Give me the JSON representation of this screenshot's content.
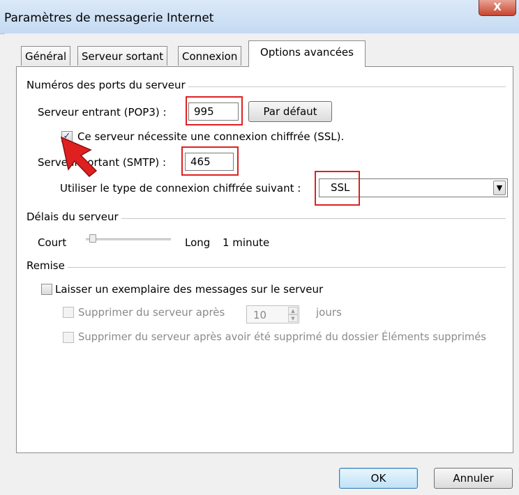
{
  "window": {
    "title": "Paramètres de messagerie Internet",
    "close_label": "X"
  },
  "tabs": [
    {
      "label": "Général",
      "active": false
    },
    {
      "label": "Serveur sortant",
      "active": false
    },
    {
      "label": "Connexion",
      "active": false
    },
    {
      "label": "Options avancées",
      "active": true
    }
  ],
  "ports": {
    "group_label": "Numéros des ports du serveur",
    "incoming_label": "Serveur entrant (POP3) :",
    "incoming_value": "995",
    "default_button": "Par défaut",
    "ssl_checkbox_label": "Ce serveur nécessite une connexion chiffrée (SSL).",
    "ssl_checked": true,
    "outgoing_label": "Serveur sortant (SMTP) :",
    "outgoing_value": "465",
    "encryption_label": "Utiliser le type de connexion chiffrée suivant :",
    "encryption_value": "SSL"
  },
  "timeouts": {
    "group_label": "Délais du serveur",
    "short_label": "Court",
    "long_label": "Long",
    "value_label": "1 minute",
    "slider_level": 0.05
  },
  "delivery": {
    "group_label": "Remise",
    "leave_copy_label": "Laisser un exemplaire des messages sur le serveur",
    "leave_copy_checked": false,
    "remove_after_label": "Supprimer du serveur après",
    "remove_after_value": "10",
    "days_label": "jours",
    "remove_deleted_label": "Supprimer du serveur après avoir été supprimé du dossier Éléments supprimés"
  },
  "footer": {
    "ok_label": "OK",
    "cancel_label": "Annuler"
  },
  "colors": {
    "highlight": "#e02020",
    "pointer_arrow": "#e02020"
  }
}
